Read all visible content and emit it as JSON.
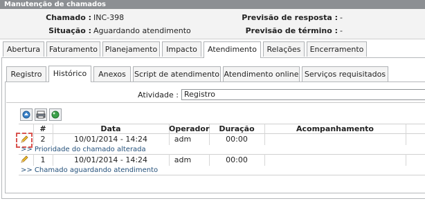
{
  "window": {
    "title": "Manutenção de chamados"
  },
  "info": {
    "chamado_label": "Chamado :",
    "chamado_value": "INC-398",
    "situacao_label": "Situação :",
    "situacao_value": "Aguardando atendimento",
    "previsao_resposta_label": "Previsão de resposta :",
    "previsao_resposta_value": "-",
    "previsao_termino_label": "Previsão de término :",
    "previsao_termino_value": "-"
  },
  "main_tabs": [
    "Abertura",
    "Faturamento",
    "Planejamento",
    "Impacto",
    "Atendimento",
    "Relações",
    "Encerramento"
  ],
  "main_active": "Atendimento",
  "sub_tabs": [
    "Registro",
    "Histórico",
    "Anexos",
    "Script de atendimento",
    "Atendimento online",
    "Serviços requisitados"
  ],
  "sub_active": "Histórico",
  "activity": {
    "label": "Atividade :",
    "value": "Registro"
  },
  "toolbar": {
    "icons": [
      "export-icon",
      "print-icon",
      "refresh-icon"
    ]
  },
  "table": {
    "columns": [
      "#",
      "Data",
      "Operador",
      "Duração",
      "Acompanhamento"
    ],
    "rows": [
      {
        "num": "2",
        "data": "10/01/2014 - 14:24",
        "operador": "adm",
        "duracao": "00:00",
        "acompanhamento": "",
        "note": ">> Prioridade do chamado alterada"
      },
      {
        "num": "1",
        "data": "10/01/2014 - 14:24",
        "operador": "adm",
        "duracao": "00:00",
        "acompanhamento": "",
        "note": ">> Chamado aguardando atendimento"
      }
    ]
  },
  "colors": {
    "titlebar": "#8c8f93",
    "note": "#24507a",
    "highlight": "#d9534f"
  }
}
